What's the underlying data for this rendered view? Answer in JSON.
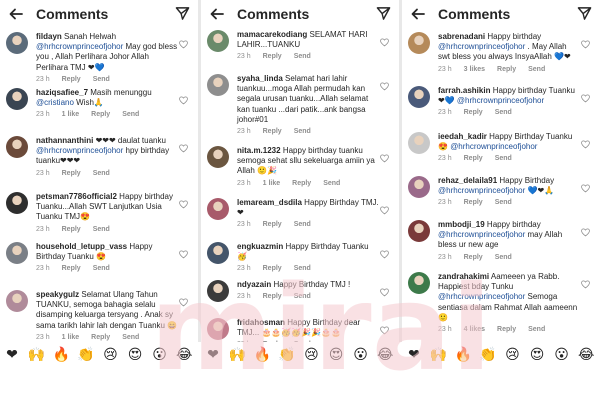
{
  "colors": {
    "accent": "#1e4f96",
    "meta": "#8e8e8e",
    "heart": "#ed4956",
    "watermark": "#f4c8cd"
  },
  "watermark": {
    "text": "mirai"
  },
  "panels": [
    {
      "header": {
        "title": "Comments",
        "back_icon": "arrow-left-icon",
        "send_icon": "send-icon"
      },
      "comments": [
        {
          "username": "fildayn",
          "mention": "",
          "text": "Sanah Helwah @hrhcrownprinceofjohor May god bless you , Allah Perlihara Johor Allah Perlihara TMJ ❤💙",
          "time": "23 h",
          "likes": "",
          "reply": "Reply",
          "send": "Send",
          "avatar_color": "#5b6b7a"
        },
        {
          "username": "haziqsafiee_7",
          "mention": "",
          "text": "Masih menunggu @cristiano Wish🙏",
          "time": "23 h",
          "likes": "1 like",
          "reply": "Reply",
          "send": "Send",
          "avatar_color": "#3a4552"
        },
        {
          "username": "nathannanthini",
          "mention": "",
          "text": "❤❤❤ daulat tuanku @hrhcrownprinceofjohor hpy birthday tuanku❤❤❤",
          "time": "23 h",
          "likes": "",
          "reply": "Reply",
          "send": "Send",
          "avatar_color": "#6b4a3a"
        },
        {
          "username": "petsman7786official2",
          "mention": "",
          "text": "Happy birthday Tuanku...Allah SWT Lanjutkan Usia Tuanku TMJ😍",
          "time": "23 h",
          "likes": "",
          "reply": "Reply",
          "send": "Send",
          "avatar_color": "#2e2e2e"
        },
        {
          "username": "household_letupp_vass",
          "mention": "",
          "text": "Happy Birthday Tuanku 😍",
          "time": "23 h",
          "likes": "",
          "reply": "Reply",
          "send": "Send",
          "avatar_color": "#7a7f86"
        },
        {
          "username": "speakygulz",
          "mention": "",
          "text": "Selamat Ulang Tahun TUANKU, semoga bahagia selalu disamping keluarga tersyang . Anak sy sama tarikh lahir lah dengan Tuanku 😄",
          "time": "23 h",
          "likes": "1 like",
          "reply": "Reply",
          "send": "Send",
          "avatar_color": "#b08b9a"
        }
      ]
    },
    {
      "header": {
        "title": "Comments",
        "back_icon": "arrow-left-icon",
        "send_icon": "send-icon"
      },
      "comments": [
        {
          "username": "mamacarekodiang",
          "mention": "",
          "text": "SELAMAT HARI LAHIR...TUANKU",
          "time": "23 h",
          "likes": "",
          "reply": "Reply",
          "send": "Send",
          "avatar_color": "#6a8a6a"
        },
        {
          "username": "syaha_linda",
          "mention": "",
          "text": "Selamat hari lahir tuankuu...moga Allah permudah kan segala urusan tuanku...Allah selamat kan tuanku ...dari patik...ank bangsa johor#01",
          "time": "23 h",
          "likes": "",
          "reply": "Reply",
          "send": "Send",
          "avatar_color": "#8e8e8e"
        },
        {
          "username": "nita.m.1232",
          "mention": "",
          "text": "Happy birthday tuanku semoga sehat sllu sekeluarga amiin ya Allah 🙂🎉",
          "time": "23 h",
          "likes": "1 like",
          "reply": "Reply",
          "send": "Send",
          "avatar_color": "#6b5640"
        },
        {
          "username": "lemaream_dsdila",
          "mention": "",
          "text": "Happy Birthday TMJ. ❤",
          "time": "23 h",
          "likes": "",
          "reply": "Reply",
          "send": "Send",
          "avatar_color": "#a85a6a"
        },
        {
          "username": "engkuazmin",
          "mention": "",
          "text": "Happy Birthday Tuanku 🥳",
          "time": "23 h",
          "likes": "",
          "reply": "Reply",
          "send": "Send",
          "avatar_color": "#44556a"
        },
        {
          "username": "ndyazain",
          "mention": "",
          "text": "Happy Birthday TMJ !",
          "time": "23 h",
          "likes": "",
          "reply": "Reply",
          "send": "Send",
          "avatar_color": "#3b3b3b"
        },
        {
          "username": "fridahosman",
          "mention": "",
          "text": "Happy Birthday dear TMJ... 🎂🎂🥳🥳🎉🎉🎂🎂",
          "time": "23 h",
          "likes": "",
          "reply": "Reply",
          "send": "Send",
          "avatar_color": "#c07a8a"
        }
      ]
    },
    {
      "header": {
        "title": "Comments",
        "back_icon": "arrow-left-icon",
        "send_icon": "send-icon"
      },
      "comments": [
        {
          "username": "sabrenadani",
          "mention": "",
          "text": "Happy birthday @hrhcrownprinceofjohor . May Allah swt bless you always InsyaAllah 💙❤",
          "time": "23 h",
          "likes": "3 likes",
          "reply": "Reply",
          "send": "Send",
          "avatar_color": "#b58a5a"
        },
        {
          "username": "farrah.ashikin",
          "mention": "",
          "text": "Happy birthday Tuanku ❤💙 @hrhcrownprinceofjohor",
          "time": "23 h",
          "likes": "",
          "reply": "Reply",
          "send": "Send",
          "avatar_color": "#4a5a7a"
        },
        {
          "username": "ieedah_kadir",
          "mention": "",
          "text": "Happy Birthday Tuanku😍 @hrhcrownprinceofjohor",
          "time": "23 h",
          "likes": "",
          "reply": "Reply",
          "send": "Send",
          "avatar_color": "#c8c8c8"
        },
        {
          "username": "rehaz_delaila91",
          "mention": "",
          "text": "Happy Birthday @hrhcrownprinceofjohor 💙❤🙏",
          "time": "23 h",
          "likes": "",
          "reply": "Reply",
          "send": "Send",
          "avatar_color": "#9a6a8a"
        },
        {
          "username": "mmbodji_19",
          "mention": "",
          "text": "Happy birthday @hrhcrownprinceofjohor may Allah bless ur new age",
          "time": "23 h",
          "likes": "",
          "reply": "Reply",
          "send": "Send",
          "avatar_color": "#7a3a3a"
        },
        {
          "username": "zandrahakimi",
          "mention": "",
          "text": "Aameeen ya Rabb. Happiest bday Tunku @hrhcrownprinceofjohor Semoga sentiasa dalam Rahmat Allah aameenn 🙂",
          "time": "23 h",
          "likes": "4 likes",
          "reply": "Reply",
          "send": "Send",
          "avatar_color": "#3d7a4a"
        }
      ]
    }
  ],
  "emoji_bar": [
    "❤",
    "🙌",
    "🔥",
    "👏",
    "😢",
    "😍",
    "😮",
    "😂"
  ]
}
